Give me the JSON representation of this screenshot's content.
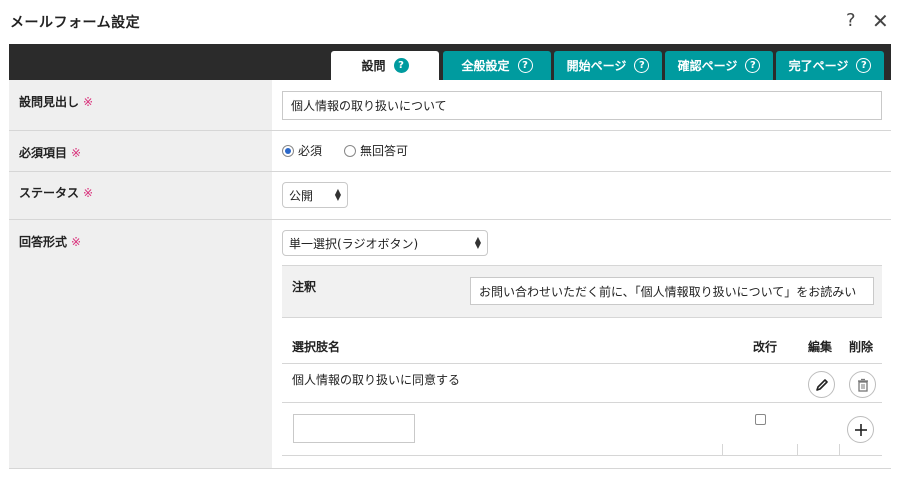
{
  "window": {
    "title": "メールフォーム設定",
    "help_glyph": "?",
    "close_glyph": "✕"
  },
  "tabs": [
    {
      "label": "設問",
      "active": true,
      "icon": "question-circle-icon"
    },
    {
      "label": "全般設定",
      "active": false,
      "icon": "question-circle-icon"
    },
    {
      "label": "開始ページ",
      "active": false,
      "icon": "question-circle-icon"
    },
    {
      "label": "確認ページ",
      "active": false,
      "icon": "question-circle-icon"
    },
    {
      "label": "完了ページ",
      "active": false,
      "icon": "question-circle-icon"
    }
  ],
  "colors": {
    "accent": "#009b9f",
    "required": "#d9307a",
    "tabbar": "#2b2b2b"
  },
  "form": {
    "required_mark": "※",
    "question_heading": {
      "label": "設問見出し",
      "value": "個人情報の取り扱いについて"
    },
    "required_item": {
      "label": "必須項目",
      "options": [
        {
          "label": "必須",
          "checked": true
        },
        {
          "label": "無回答可",
          "checked": false
        }
      ]
    },
    "status": {
      "label": "ステータス",
      "value": "公開"
    },
    "answer_format": {
      "label": "回答形式",
      "value": "単一選択(ラジオボタン)",
      "annotation": {
        "label": "注釈",
        "value": "お問い合わせいただく前に、「個人情報取り扱いについて」をお読みい"
      },
      "choices_table": {
        "headers": {
          "name": "選択肢名",
          "newline": "改行",
          "edit": "編集",
          "delete": "削除"
        },
        "rows": [
          {
            "name": "個人情報の取り扱いに同意する"
          }
        ],
        "new_choice_value": ""
      }
    }
  }
}
